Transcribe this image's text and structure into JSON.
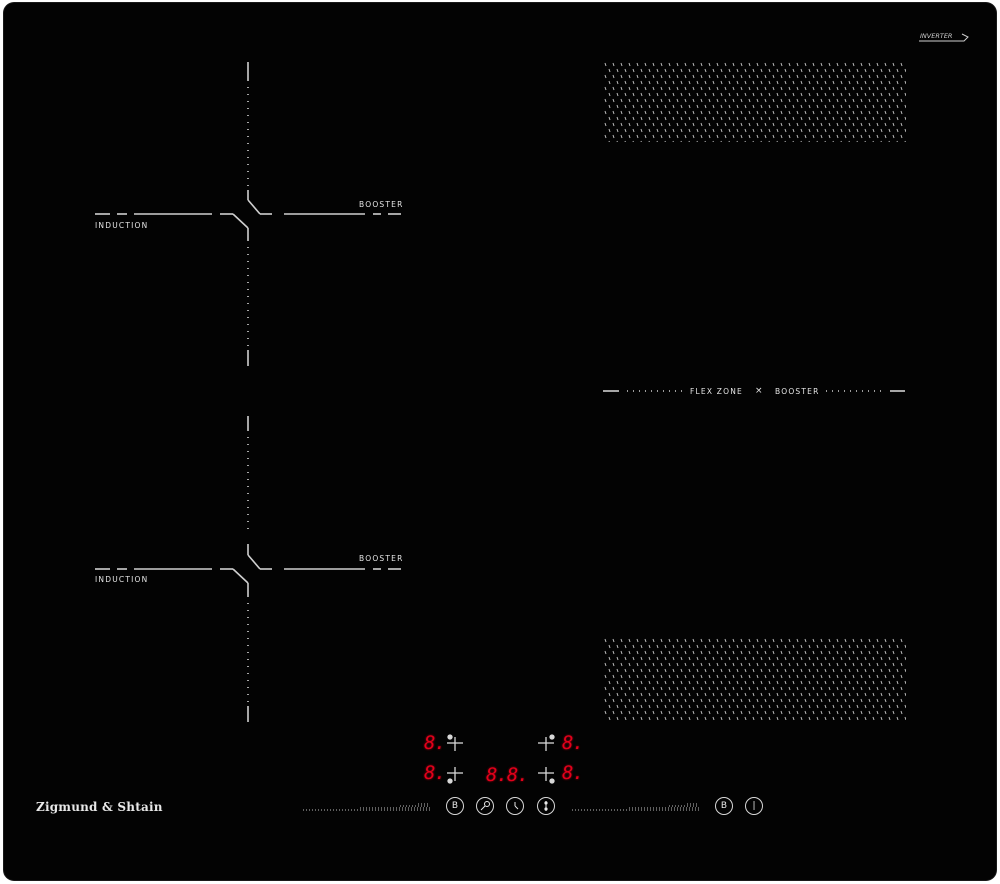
{
  "brand": {
    "name": "Zigmund & Shtain",
    "badge": "INVERTER"
  },
  "zones": {
    "left_top": {
      "left_label": "INDUCTION",
      "right_label": "BOOSTER"
    },
    "left_bottom": {
      "left_label": "INDUCTION",
      "right_label": "BOOSTER"
    },
    "flex": {
      "label": "FLEX ZONE",
      "separator": "×",
      "booster": "BOOSTER"
    }
  },
  "display": {
    "top_left_digit": "8.",
    "bottom_left_digit": "8.",
    "timer": "8.8.",
    "top_right_digit": "8.",
    "bottom_right_digit": "8."
  },
  "controls": {
    "left_booster": "B",
    "right_booster": "B",
    "power_symbol": "|",
    "colors": {
      "display": "#e3001b",
      "glass": "#030303",
      "print": "#d8d8d8"
    },
    "icons": [
      "booster-icon",
      "key-lock-icon",
      "clock-icon",
      "flex-toggle-icon",
      "power-icon"
    ]
  }
}
